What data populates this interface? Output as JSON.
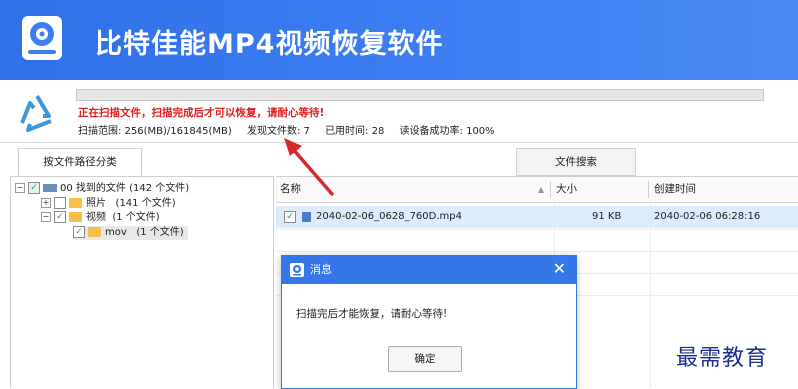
{
  "app": {
    "title": "比特佳能MP4视频恢复软件"
  },
  "scan": {
    "message": "正在扫描文件，扫描完成后才可以恢复，请耐心等待!",
    "range_label": "扫描范围: 256(MB)/161845(MB)",
    "found_label": "发现文件数: 7",
    "elapsed_label": "已用时间: 28",
    "read_success_label": "读设备成功率: 100%",
    "progress": 0
  },
  "tabs": {
    "by_path": "按文件路径分类",
    "file_search": "文件搜索"
  },
  "tree": {
    "root_label": "00 找到的文件 (142 个文件)",
    "photos_label": "照片",
    "photos_count": "(141 个文件)",
    "videos_label": "视频",
    "videos_count": "(1 个文件)",
    "mov_label": "mov",
    "mov_count": "(1 个文件)"
  },
  "list": {
    "columns": [
      "名称",
      "大小",
      "创建时间"
    ],
    "rows": [
      {
        "name": "2040-02-06_0628_760D.mp4",
        "size": "91 KB",
        "created": "2040-02-06 06:28:16"
      }
    ]
  },
  "dialog": {
    "title": "消息",
    "message": "扫描完后才能恢复，请耐心等待!",
    "ok": "确定"
  },
  "watermark": "最需教育",
  "colors": {
    "banner": "#3c7ef2",
    "warning": "#e02020",
    "selection": "#dcecfc",
    "arrow": "#d42a2a"
  }
}
